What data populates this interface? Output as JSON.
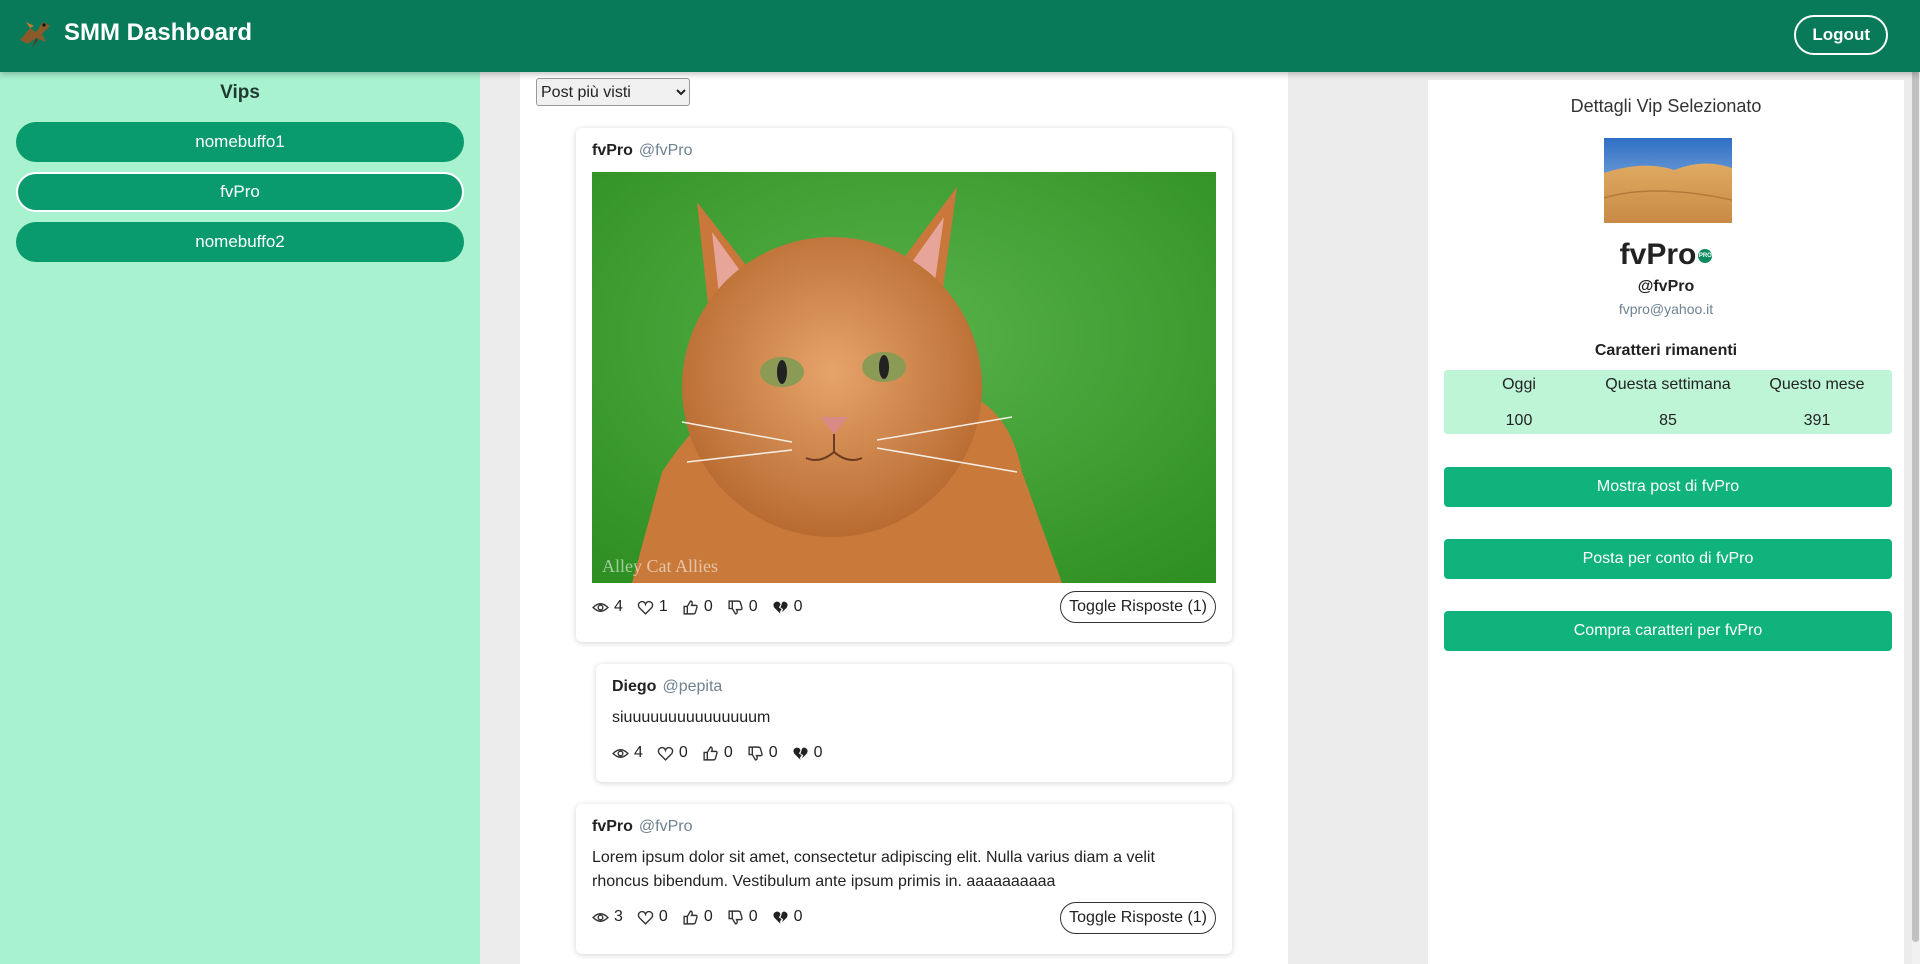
{
  "header": {
    "title": "SMM Dashboard",
    "logout_label": "Logout"
  },
  "sidebar": {
    "title": "Vips",
    "items": [
      {
        "label": "nomebuffo1",
        "selected": false
      },
      {
        "label": "fvPro",
        "selected": true
      },
      {
        "label": "nomebuffo2",
        "selected": false
      }
    ]
  },
  "feed": {
    "sort_selected": "Post più visti",
    "posts": [
      {
        "author": "fvPro",
        "handle": "@fvPro",
        "image_watermark": "Alley Cat Allies",
        "views": "4",
        "likes": "1",
        "upvotes": "0",
        "downvotes": "0",
        "dislikes": "0",
        "toggle_label": "Toggle Risposte (1)"
      },
      {
        "author": "Diego",
        "handle": "@pepita",
        "text": "siuuuuuuuuuuuuuuum",
        "views": "4",
        "likes": "0",
        "upvotes": "0",
        "downvotes": "0",
        "dislikes": "0"
      },
      {
        "author": "fvPro",
        "handle": "@fvPro",
        "text_line1": "Lorem ipsum dolor sit amet, consectetur adipiscing elit. Nulla varius diam a velit",
        "text_line2": "rhoncus bibendum. Vestibulum ante ipsum primis in. aaaaaaaaaa",
        "views": "3",
        "likes": "0",
        "upvotes": "0",
        "downvotes": "0",
        "dislikes": "0",
        "toggle_label": "Toggle Risposte (1)"
      }
    ]
  },
  "details": {
    "title": "Dettagli Vip Selezionato",
    "name": "fvPro",
    "badge": "PRO",
    "handle": "@fvPro",
    "email": "fvpro@yahoo.it",
    "chars_title": "Caratteri rimanenti",
    "chars": [
      {
        "label": "Oggi",
        "value": "100"
      },
      {
        "label": "Questa settimana",
        "value": "85"
      },
      {
        "label": "Questo mese",
        "value": "391"
      }
    ],
    "buttons": {
      "show_posts": "Mostra post di fvPro",
      "post_for": "Posta per conto di fvPro",
      "buy_chars": "Compra caratteri per fvPro"
    }
  },
  "colors": {
    "header": "#087a59",
    "sidebar": "#a8f2cf",
    "vip_button": "#099a6d",
    "action_button": "#10b37c",
    "chars_bg": "#bff5d7"
  }
}
